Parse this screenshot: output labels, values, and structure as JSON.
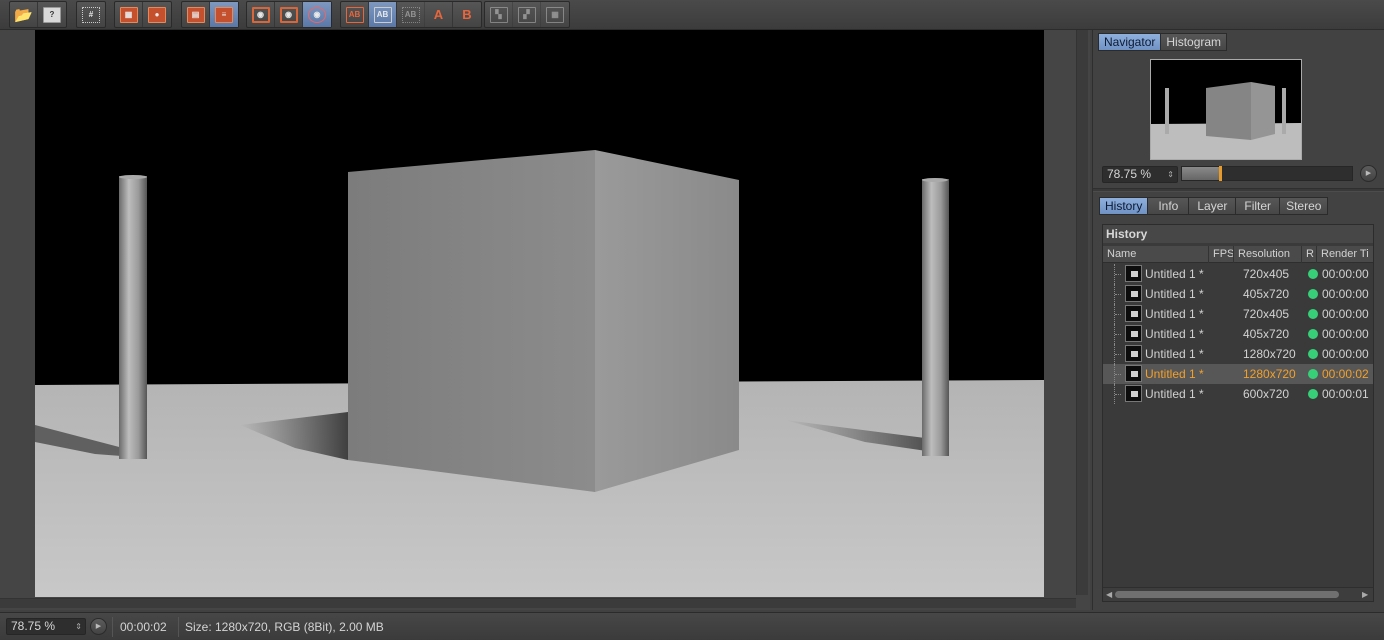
{
  "toolbar": {
    "groups": [
      {
        "buttons": [
          {
            "name": "open-file-button",
            "icon": "folder-open-icon"
          },
          {
            "name": "save-file-button",
            "icon": "floppy-question-icon"
          }
        ]
      },
      {
        "buttons": [
          {
            "name": "grid-select-button",
            "icon": "grid-icon"
          }
        ]
      },
      {
        "buttons": [
          {
            "name": "render-region-button",
            "icon": "render-region-icon"
          },
          {
            "name": "render-region-user-button",
            "icon": "render-user-icon"
          }
        ]
      },
      {
        "buttons": [
          {
            "name": "delete-picture-button",
            "icon": "trash-picture-icon"
          },
          {
            "name": "delete-all-button",
            "icon": "trash-list-icon"
          }
        ]
      },
      {
        "buttons": [
          {
            "name": "view-single-button",
            "icon": "eye-frame-icon"
          },
          {
            "name": "view-pass-button",
            "icon": "eye-frame-alt-icon"
          },
          {
            "name": "view-layers-button",
            "icon": "layers-eye-icon"
          }
        ]
      },
      {
        "buttons": [
          {
            "name": "ab-compare-button",
            "icon": "ab-icon",
            "label": "AB"
          },
          {
            "name": "ab-split-button",
            "icon": "ab-split-icon",
            "label": "AB"
          },
          {
            "name": "ab-swap-button",
            "icon": "ab-swap-icon",
            "label": "AB"
          },
          {
            "name": "set-a-button",
            "icon": "set-a-icon",
            "label": "A"
          },
          {
            "name": "set-b-button",
            "icon": "set-b-icon",
            "label": "B"
          }
        ]
      },
      {
        "buttons": [
          {
            "name": "stereo-1-button",
            "icon": "stereo-icon"
          },
          {
            "name": "stereo-2-button",
            "icon": "stereo-alt-icon"
          },
          {
            "name": "stereo-3-button",
            "icon": "stereo-grid-icon"
          }
        ]
      }
    ]
  },
  "right_panel": {
    "top_tabs": [
      "Navigator",
      "Histogram"
    ],
    "active_top_tab": "Navigator",
    "zoom_value": "78.75 %",
    "zoom_fraction": 0.22,
    "bottom_tabs": [
      "History",
      "Info",
      "Layer",
      "Filter",
      "Stereo"
    ],
    "active_bottom_tab": "History",
    "history": {
      "title": "History",
      "columns": [
        "Name",
        "FPS",
        "Resolution",
        "R",
        "Render Ti"
      ],
      "rows": [
        {
          "name": "Untitled 1 *",
          "resolution": "720x405",
          "render_time": "00:00:00",
          "selected": false
        },
        {
          "name": "Untitled 1 *",
          "resolution": "405x720",
          "render_time": "00:00:00",
          "selected": false
        },
        {
          "name": "Untitled 1 *",
          "resolution": "720x405",
          "render_time": "00:00:00",
          "selected": false
        },
        {
          "name": "Untitled 1 *",
          "resolution": "405x720",
          "render_time": "00:00:00",
          "selected": false
        },
        {
          "name": "Untitled 1 *",
          "resolution": "1280x720",
          "render_time": "00:00:00",
          "selected": false
        },
        {
          "name": "Untitled 1 *",
          "resolution": "1280x720",
          "render_time": "00:00:02",
          "selected": true
        },
        {
          "name": "Untitled 1 *",
          "resolution": "600x720",
          "render_time": "00:00:01",
          "selected": false
        }
      ],
      "status_color": "#37d078",
      "selected_color": "#f2a02a"
    }
  },
  "statusbar": {
    "zoom": "78.75 %",
    "time": "00:00:02",
    "info": "Size: 1280x720, RGB (8Bit), 2.00 MB"
  }
}
